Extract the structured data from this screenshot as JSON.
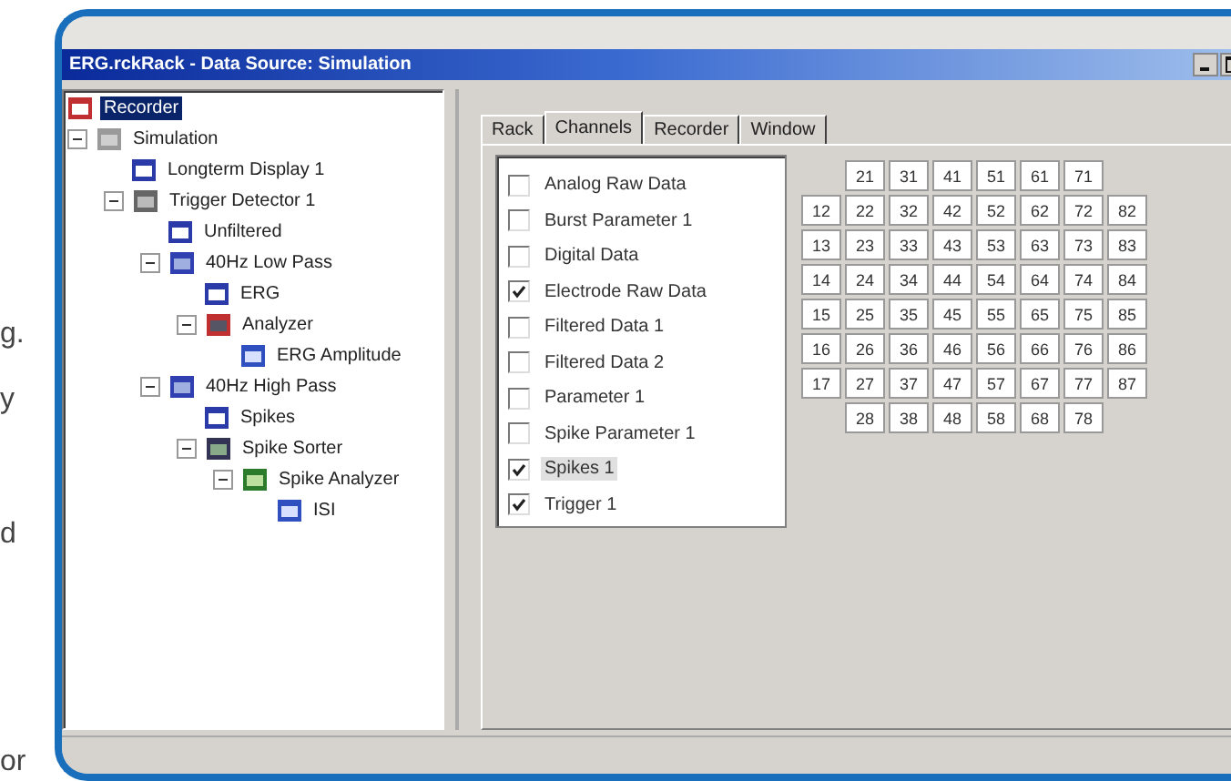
{
  "margin_text": [
    "g.",
    "y",
    "d",
    "or"
  ],
  "window": {
    "title": "ERG.rckRack - Data Source: Simulation"
  },
  "tree": [
    {
      "label": "Recorder",
      "kind": "recorder",
      "selected": true
    },
    {
      "label": "Simulation",
      "kind": "source",
      "selected": false,
      "expanded": true,
      "children": [
        {
          "label": "Longterm Display 1",
          "kind": "display",
          "selected": false
        },
        {
          "label": "Trigger Detector 1",
          "kind": "detector",
          "selected": false,
          "expanded": true,
          "children": [
            {
              "label": "Unfiltered",
              "kind": "display",
              "selected": false
            },
            {
              "label": "40Hz Low Pass",
              "kind": "filter",
              "selected": false,
              "expanded": true,
              "children": [
                {
                  "label": "ERG",
                  "kind": "display",
                  "selected": false
                },
                {
                  "label": "Analyzer",
                  "kind": "analyzer",
                  "selected": false,
                  "expanded": true,
                  "children": [
                    {
                      "label": "ERG Amplitude",
                      "kind": "chart",
                      "selected": false
                    }
                  ]
                }
              ]
            },
            {
              "label": "40Hz High Pass",
              "kind": "filter",
              "selected": false,
              "expanded": true,
              "children": [
                {
                  "label": "Spikes",
                  "kind": "display",
                  "selected": false
                },
                {
                  "label": "Spike Sorter",
                  "kind": "sorter",
                  "selected": false,
                  "expanded": true,
                  "children": [
                    {
                      "label": "Spike Analyzer",
                      "kind": "spikeanalyzer",
                      "selected": false,
                      "expanded": true,
                      "children": [
                        {
                          "label": "ISI",
                          "kind": "chart",
                          "selected": false
                        }
                      ]
                    }
                  ]
                }
              ]
            }
          ]
        }
      ]
    }
  ],
  "tabs": [
    {
      "label": "Rack",
      "selected": false
    },
    {
      "label": "Channels",
      "selected": true
    },
    {
      "label": "Recorder",
      "selected": false
    },
    {
      "label": "Window",
      "selected": false
    }
  ],
  "channels": [
    {
      "label": "Analog Raw Data",
      "checked": false,
      "selected": false
    },
    {
      "label": "Burst Parameter 1",
      "checked": false,
      "selected": false
    },
    {
      "label": "Digital Data",
      "checked": false,
      "selected": false
    },
    {
      "label": "Electrode Raw Data",
      "checked": true,
      "selected": false
    },
    {
      "label": "Filtered Data 1",
      "checked": false,
      "selected": false
    },
    {
      "label": "Filtered Data 2",
      "checked": false,
      "selected": false
    },
    {
      "label": "Parameter 1",
      "checked": false,
      "selected": false
    },
    {
      "label": "Spike Parameter 1",
      "checked": false,
      "selected": false
    },
    {
      "label": "Spikes 1",
      "checked": true,
      "selected": true
    },
    {
      "label": "Trigger 1",
      "checked": true,
      "selected": false
    }
  ],
  "electrodes": [
    {
      "kind": "short",
      "cells": [
        "21",
        "31",
        "41",
        "51",
        "61",
        "71"
      ]
    },
    {
      "kind": "full",
      "cells": [
        "12",
        "22",
        "32",
        "42",
        "52",
        "62",
        "72",
        "82"
      ]
    },
    {
      "kind": "full",
      "cells": [
        "13",
        "23",
        "33",
        "43",
        "53",
        "63",
        "73",
        "83"
      ]
    },
    {
      "kind": "full",
      "cells": [
        "14",
        "24",
        "34",
        "44",
        "54",
        "64",
        "74",
        "84"
      ]
    },
    {
      "kind": "full",
      "cells": [
        "15",
        "25",
        "35",
        "45",
        "55",
        "65",
        "75",
        "85"
      ]
    },
    {
      "kind": "full",
      "cells": [
        "16",
        "26",
        "36",
        "46",
        "56",
        "66",
        "76",
        "86"
      ]
    },
    {
      "kind": "full",
      "cells": [
        "17",
        "27",
        "37",
        "47",
        "57",
        "67",
        "77",
        "87"
      ]
    },
    {
      "kind": "short",
      "cells": [
        "28",
        "38",
        "48",
        "58",
        "68",
        "78"
      ]
    }
  ]
}
